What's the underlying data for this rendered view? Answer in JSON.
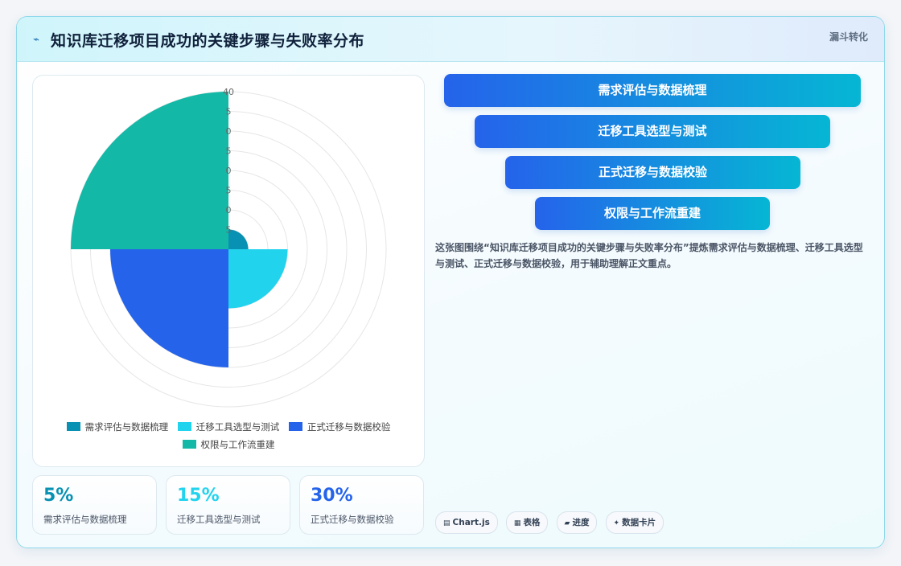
{
  "header": {
    "icon": "⌁",
    "title": "知识库迁移项目成功的关键步骤与失败率分布",
    "tag": "漏斗转化"
  },
  "colors": {
    "accent": "#0891b2",
    "funnel_start": "#2563eb",
    "funnel_end": "#06b6d4"
  },
  "chart_data": {
    "type": "polarArea",
    "title": "",
    "categories": [
      "需求评估与数据梳理",
      "迁移工具选型与测试",
      "正式迁移与数据校验",
      "权限与工作流重建"
    ],
    "values": [
      5,
      15,
      30,
      40
    ],
    "colors": [
      "#0891b2",
      "#22d3ee",
      "#2563eb",
      "#14b8a6"
    ],
    "r_range": [
      0,
      40
    ],
    "r_ticks": [
      5,
      10,
      15,
      20,
      25,
      30,
      35,
      40
    ],
    "r_tick_labels_visible": [
      "5",
      "0",
      "5",
      "0",
      "5",
      "0",
      "5",
      "40"
    ],
    "legend_position": "bottom",
    "grid": true
  },
  "stats": [
    {
      "value": "5%",
      "label": "需求评估与数据梳理",
      "color": "#0891b2"
    },
    {
      "value": "15%",
      "label": "迁移工具选型与测试",
      "color": "#22d3ee"
    },
    {
      "value": "30%",
      "label": "正式迁移与数据校验",
      "color": "#2563eb"
    }
  ],
  "funnel": {
    "steps": [
      "需求评估与数据梳理",
      "迁移工具选型与测试",
      "正式迁移与数据校验",
      "权限与工作流重建"
    ]
  },
  "description": "这张图围绕“知识库迁移项目成功的关键步骤与失败率分布”提炼需求评估与数据梳理、迁移工具选型与测试、正式迁移与数据校验，用于辅助理解正文重点。",
  "chips": [
    {
      "icon": "▤",
      "icon_name": "chart-icon",
      "label": "Chart.js"
    },
    {
      "icon": "▦",
      "icon_name": "table-icon",
      "label": "表格"
    },
    {
      "icon": "▰",
      "icon_name": "progress-icon",
      "label": "进度"
    },
    {
      "icon": "✦",
      "icon_name": "card-icon",
      "label": "数据卡片"
    }
  ]
}
